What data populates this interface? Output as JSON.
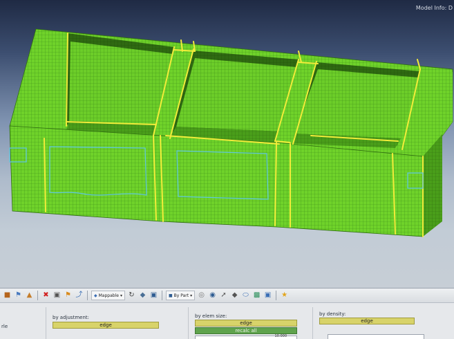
{
  "viewport": {
    "model_info": "Model Info: D",
    "mesh_color": "#6fd22a",
    "edge_color": "#f2ec3a",
    "cut_color": "#5fc7d9"
  },
  "toolbar": {
    "mappable_label": "Mappable",
    "by_part_label": "By Part",
    "icons": [
      "component-icon",
      "bookmark-icon",
      "visualize-icon",
      "delete-icon",
      "cube-icon",
      "tag-icon",
      "arrow-icon",
      "mappable-icon",
      "freehand-icon",
      "shape-icon",
      "view-cube-icon",
      "by-part-icon",
      "globe-icon",
      "shade-icon",
      "line-icon",
      "diamond-icon",
      "ellipse-icon",
      "gauge-icon",
      "monitor-icon",
      "star-icon"
    ]
  },
  "panel": {
    "left_label": "rle",
    "by_adjustment_label": "by adjustment:",
    "by_adjustment_button": "edge",
    "by_elem_size_label": "by elem size:",
    "by_elem_size_button": "edge",
    "recalc_all_button": "recalc all",
    "by_density_label": "by density:",
    "by_density_button": "edge",
    "partial_value": "10.000"
  }
}
